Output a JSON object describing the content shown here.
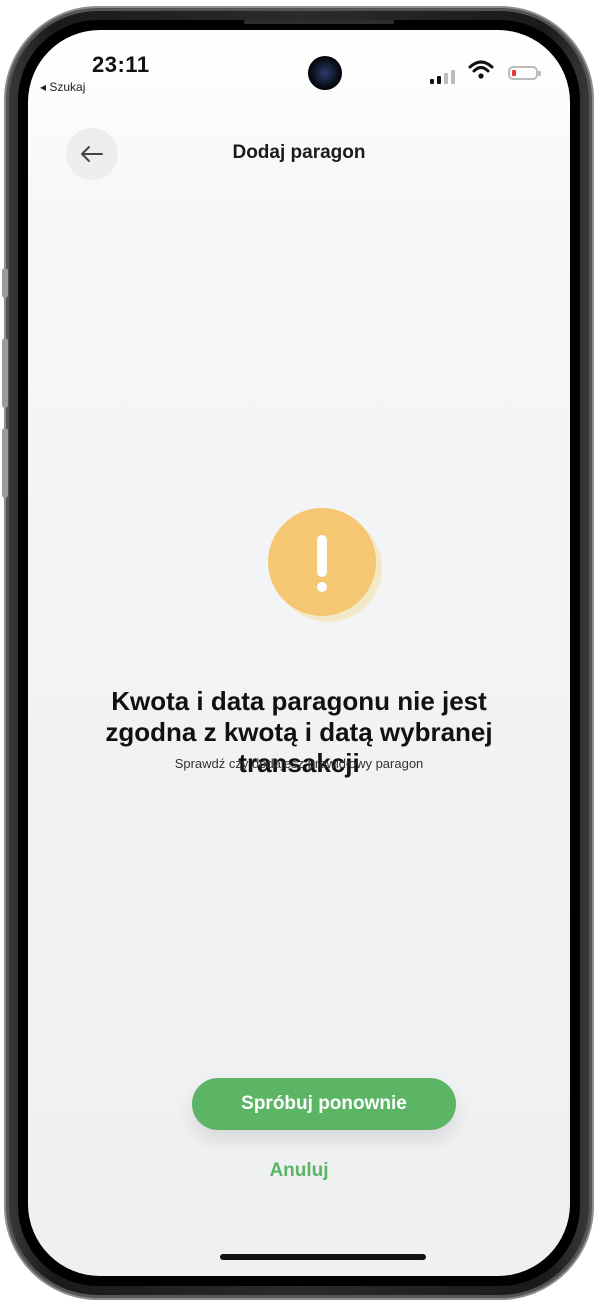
{
  "status_bar": {
    "time": "23:11",
    "back_app": "◂ Szukaj",
    "battery_color": "#e53935"
  },
  "header": {
    "title": "Dodaj paragon",
    "back_icon": "arrow-left-icon"
  },
  "alert": {
    "icon": "exclamation-icon",
    "icon_color": "#f5c772",
    "title": "Kwota i data paragonu nie jest zgodna z kwotą i datą wybranej transakcji",
    "subtitle": "Sprawdź czy dodajesz prawidłowy paragon"
  },
  "actions": {
    "retry_label": "Spróbuj ponownie",
    "cancel_label": "Anuluj",
    "accent_color": "#5cb465"
  }
}
